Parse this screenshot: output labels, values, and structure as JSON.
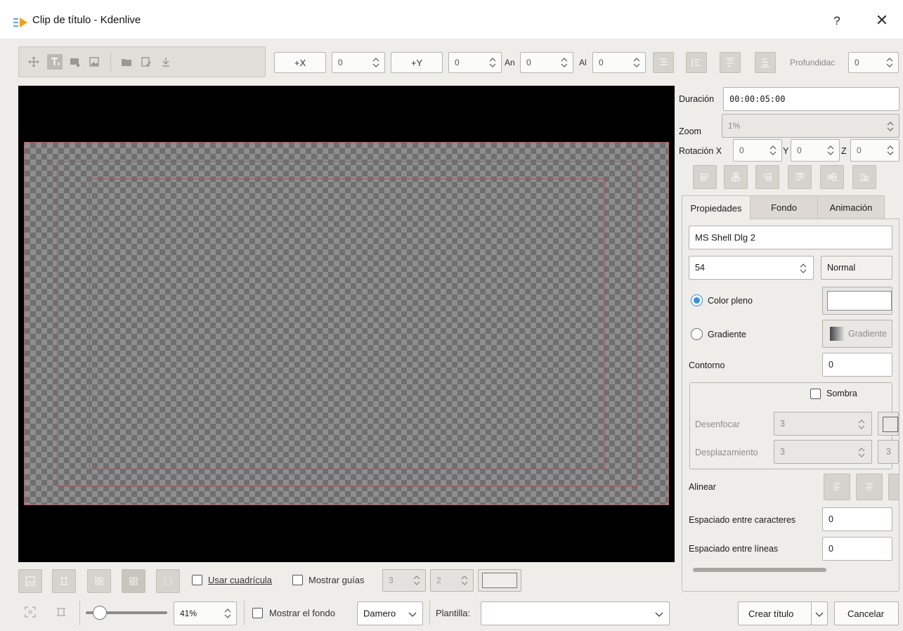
{
  "window": {
    "title": "Clip de título - Kdenlive",
    "help_label": "?",
    "close_label": "✕"
  },
  "toolbar": {
    "tools": [
      "select-icon",
      "text-icon",
      "rectangle-icon",
      "image-icon",
      "open-icon",
      "save-icon",
      "download-icon"
    ],
    "plus_x": "+X",
    "x_value": "0",
    "plus_y": "+Y",
    "y_value": "0",
    "width_label": "An",
    "width_value": "0",
    "height_label": "Al",
    "height_value": "0",
    "depth_label": "Profundidac",
    "depth_value": "0"
  },
  "right_panel": {
    "duration_label": "Duración",
    "duration_value": "00:00:05:00",
    "zoom_label": "Zoom",
    "zoom_value": "1%",
    "rotation_label": "Rotación X",
    "rot_x": "0",
    "y_label": "Y",
    "rot_y": "0",
    "z_label": "Z",
    "rot_z": "0",
    "tabs": [
      "Propiedades",
      "Fondo",
      "Animación"
    ],
    "font_name": "MS Shell Dlg 2",
    "font_size": "54",
    "font_weight": "Normal",
    "solid_color_label": "Color pleno",
    "gradient_label": "Gradiente",
    "gradient_button": "Gradiente",
    "outline_label": "Contorno",
    "outline_value": "0",
    "shadow_label": "Sombra",
    "blur_label": "Desenfocar",
    "blur_value": "3",
    "offset_label": "Desplazamiento",
    "offset_value": "3",
    "offset_value_2": "3",
    "align_label": "Alinear",
    "letter_spacing_label": "Espaciado entre caracteres",
    "letter_spacing_value": "0",
    "line_spacing_label": "Espaciado entre líneas",
    "line_spacing_value": "0"
  },
  "grid_bar": {
    "use_grid_label": "Usar cuadrícula",
    "show_guides_label": "Mostrar guías",
    "guides_h": "3",
    "guides_v": "2"
  },
  "bottom_bar": {
    "zoom_percent": "41%",
    "zoom_level": 0.12,
    "show_background_label": "Mostrar el fondo",
    "background_mode": "Damero",
    "template_label": "Plantilla:",
    "template_value": "",
    "create_label": "Crear título",
    "cancel_label": "Cancelar"
  },
  "colors": {
    "accent": "#3a8ed8",
    "canvas_bg": "#000000",
    "safe_area": "#9c5a5a"
  }
}
